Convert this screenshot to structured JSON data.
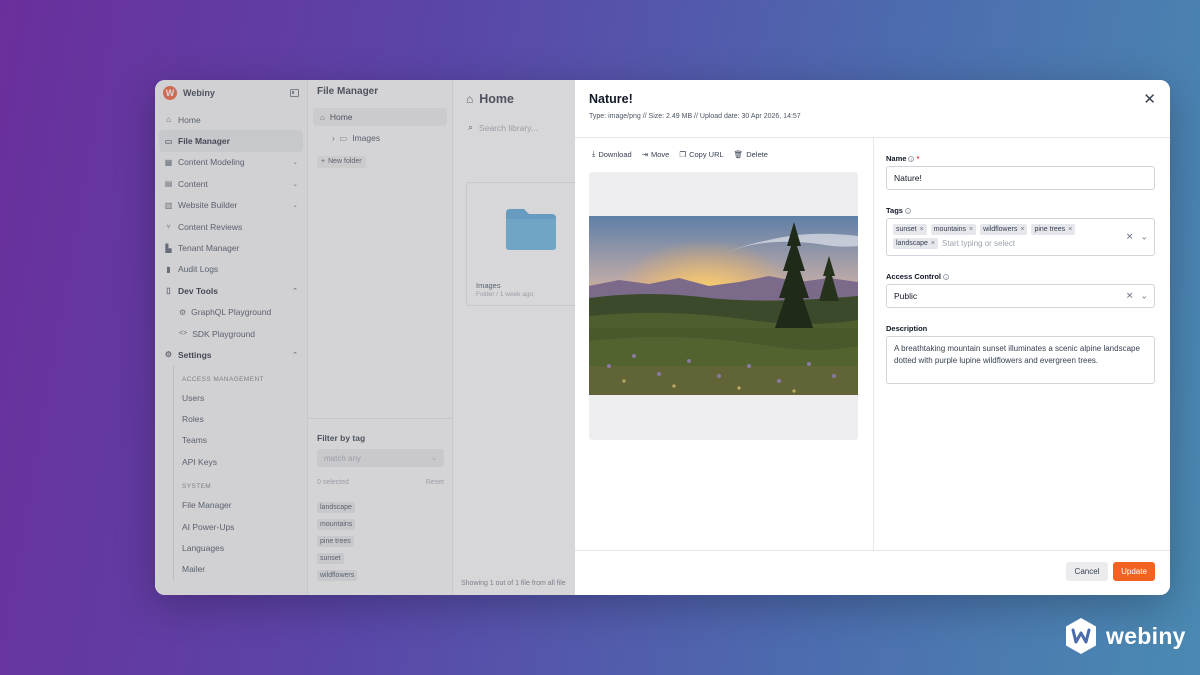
{
  "brand": {
    "name": "Webiny",
    "logo_letter": "W"
  },
  "sidebar": {
    "items": [
      {
        "label": "Home",
        "icon": "home-icon"
      },
      {
        "label": "File Manager",
        "icon": "folder-icon",
        "active": true
      },
      {
        "label": "Content Modeling",
        "icon": "layers-icon",
        "expandable": true
      },
      {
        "label": "Content",
        "icon": "table-icon",
        "expandable": true
      },
      {
        "label": "Website Builder",
        "icon": "layout-icon",
        "expandable": true
      },
      {
        "label": "Content Reviews",
        "icon": "workflow-icon"
      },
      {
        "label": "Tenant Manager",
        "icon": "building-icon"
      },
      {
        "label": "Audit Logs",
        "icon": "chart-icon"
      },
      {
        "label": "Dev Tools",
        "icon": "phone-icon",
        "expanded": true
      }
    ],
    "dev_tools": [
      {
        "label": "GraphQL Playground",
        "icon": "gear-icon"
      },
      {
        "label": "SDK Playground",
        "icon": "code-icon"
      }
    ],
    "settings": {
      "label": "Settings",
      "icon": "gear-icon"
    },
    "access_management": {
      "label": "ACCESS MANAGEMENT",
      "items": [
        "Users",
        "Roles",
        "Teams",
        "API Keys"
      ]
    },
    "system": {
      "label": "SYSTEM",
      "items": [
        "File Manager",
        "AI Power-Ups",
        "Languages",
        "Mailer"
      ]
    }
  },
  "file_manager": {
    "title": "File Manager",
    "tree": {
      "home": "Home",
      "images": "Images"
    },
    "new_folder": "New folder",
    "filter": {
      "title": "Filter by tag",
      "match_placeholder": "match any",
      "selected": "0 selected",
      "reset": "Reset",
      "tags": [
        "landscape",
        "mountains",
        "pine trees",
        "sunset",
        "wildflowers"
      ]
    }
  },
  "main": {
    "title": "Home",
    "search_placeholder": "Search library...",
    "folder": {
      "name": "Images",
      "meta": "Folder / 1 week ago"
    },
    "showing": "Showing 1 out of 1 file from all file"
  },
  "drawer": {
    "title": "Nature!",
    "meta": "Type: image/png // Size: 2.49 MB // Upload date: 30 Apr 2026, 14:57",
    "actions": {
      "download": "Download",
      "move": "Move",
      "copy_url": "Copy URL",
      "delete": "Delete"
    },
    "name": {
      "label": "Name",
      "value": "Nature!"
    },
    "tags": {
      "label": "Tags",
      "values": [
        "sunset",
        "mountains",
        "wildflowers",
        "pine trees",
        "landscape"
      ],
      "placeholder": "Start typing or select"
    },
    "access_control": {
      "label": "Access Control",
      "value": "Public"
    },
    "description": {
      "label": "Description",
      "value": "A breathtaking mountain sunset illuminates a scenic alpine landscape dotted with purple lupine wildflowers and evergreen trees."
    },
    "cancel": "Cancel",
    "update": "Update"
  },
  "corner_logo": {
    "text": "webiny"
  },
  "colors": {
    "accent": "#f26322",
    "brand_red": "#f0522b",
    "folder_blue": "#4b9fd5"
  }
}
